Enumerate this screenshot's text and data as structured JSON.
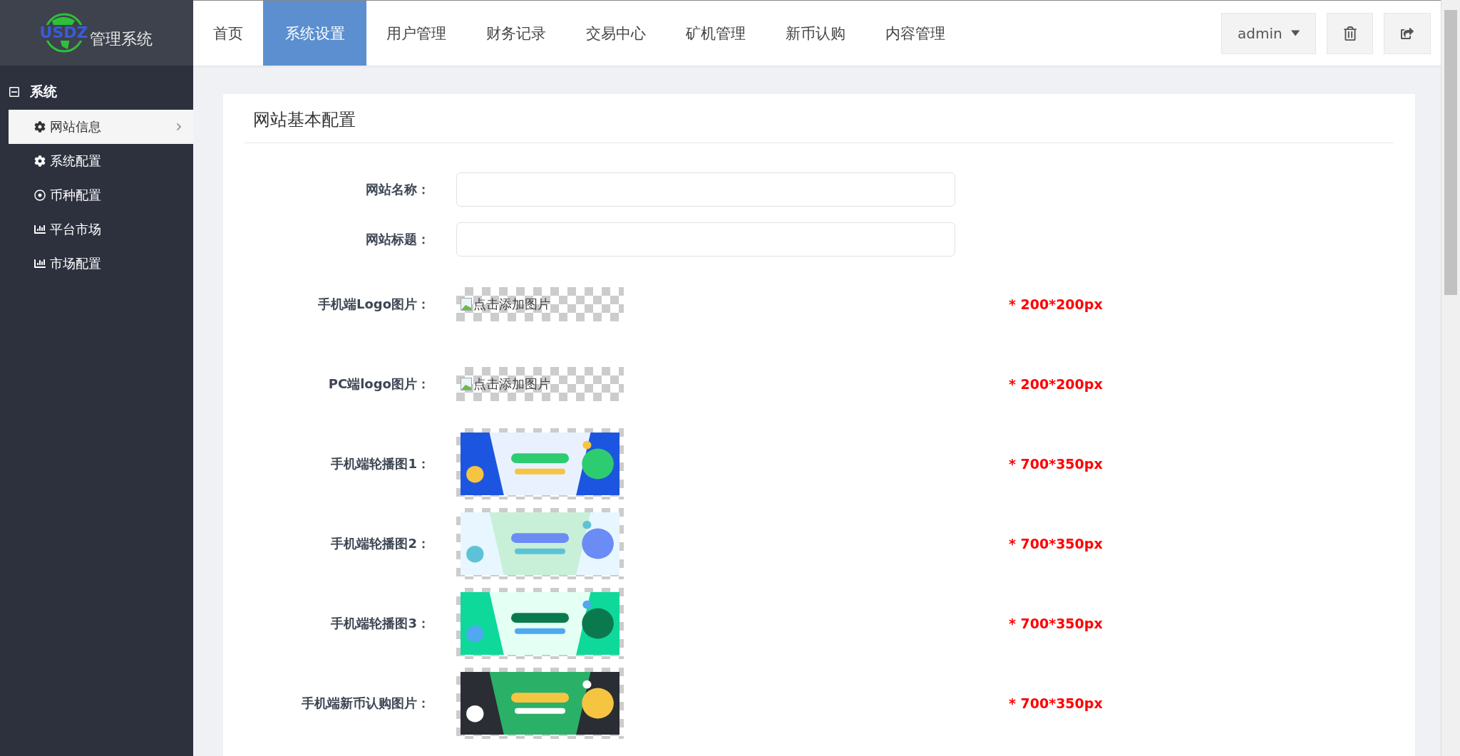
{
  "logo": {
    "mark": "USDZ",
    "title": "管理系统"
  },
  "nav": [
    {
      "label": "首页",
      "selected": false
    },
    {
      "label": "系统设置",
      "selected": true
    },
    {
      "label": "用户管理",
      "selected": false
    },
    {
      "label": "财务记录",
      "selected": false
    },
    {
      "label": "交易中心",
      "selected": false
    },
    {
      "label": "矿机管理",
      "selected": false
    },
    {
      "label": "新币认购",
      "selected": false
    },
    {
      "label": "内容管理",
      "selected": false
    }
  ],
  "user_menu": {
    "label": "admin"
  },
  "sidebar": {
    "group": {
      "label": "系统",
      "expanded": true
    },
    "items": [
      {
        "label": "网站信息",
        "kind": "gear",
        "selected": true
      },
      {
        "label": "系统配置",
        "kind": "gear",
        "selected": false
      },
      {
        "label": "币种配置",
        "kind": "target",
        "selected": false
      },
      {
        "label": "平台市场",
        "kind": "bars",
        "selected": false
      },
      {
        "label": "市场配置",
        "kind": "bars",
        "selected": false
      }
    ]
  },
  "card": {
    "title": "网站基本配置"
  },
  "fields": [
    {
      "label": "网站名称："
    },
    {
      "label": "网站标题："
    }
  ],
  "image_rows": [
    {
      "label": "手机端Logo图片：",
      "image": {
        "kind": "broken",
        "alt": "点击添加图片"
      },
      "hint": "* 200*200px"
    },
    {
      "label": "PC端logo图片：",
      "image": {
        "kind": "broken",
        "alt": "点击添加图片"
      },
      "hint": "* 200*200px"
    },
    {
      "label": "手机端轮播图1：",
      "hint": "* 700*350px"
    },
    {
      "label": "手机端轮播图2：",
      "hint": "* 700*350px"
    },
    {
      "label": "手机端轮播图3：",
      "hint": "* 700*350px"
    },
    {
      "label": "手机端新币认购图片：",
      "hint": "* 700*350px"
    }
  ]
}
